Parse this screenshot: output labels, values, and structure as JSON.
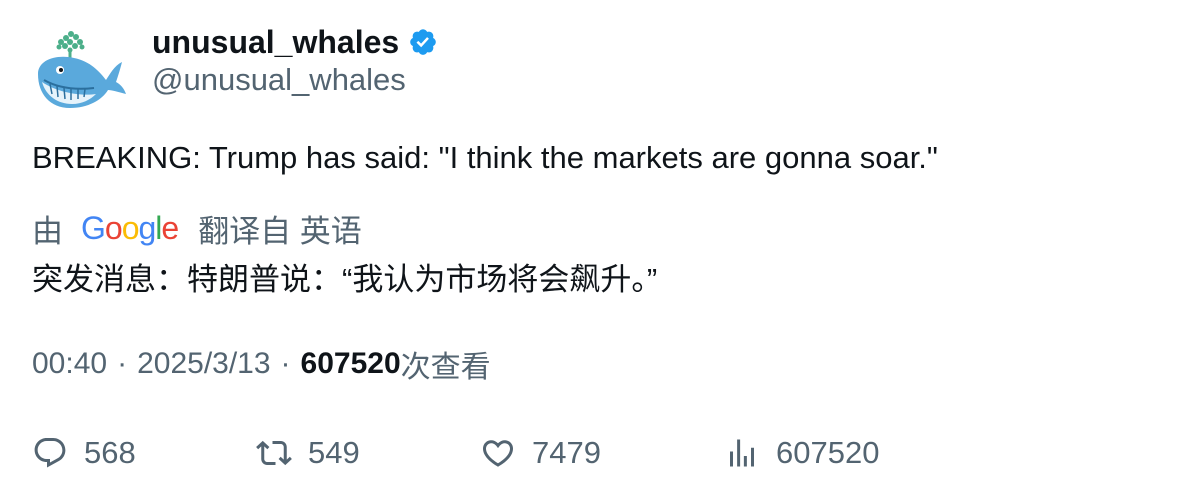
{
  "author": {
    "display_name": "unusual_whales",
    "handle": "@unusual_whales",
    "verified": true,
    "avatar_icon": "whale-avatar-icon",
    "verified_color": "#1d9bf0"
  },
  "tweet": {
    "text": "BREAKING: Trump has said: \"I think the markets are gonna soar.\""
  },
  "translation": {
    "by_label": "由",
    "provider": "Google",
    "from_label": "翻译自 英语",
    "translated_text": "突发消息：特朗普说：“我认为市场将会飙升。”"
  },
  "meta": {
    "time": "00:40",
    "separator": "·",
    "date": "2025/3/13",
    "views_count": "607520",
    "views_label": "次查看"
  },
  "actions": {
    "replies": "568",
    "retweets": "549",
    "likes": "7479",
    "views": "607520"
  },
  "colors": {
    "text_primary": "#0f1419",
    "text_secondary": "#536471",
    "accent": "#1d9bf0"
  }
}
